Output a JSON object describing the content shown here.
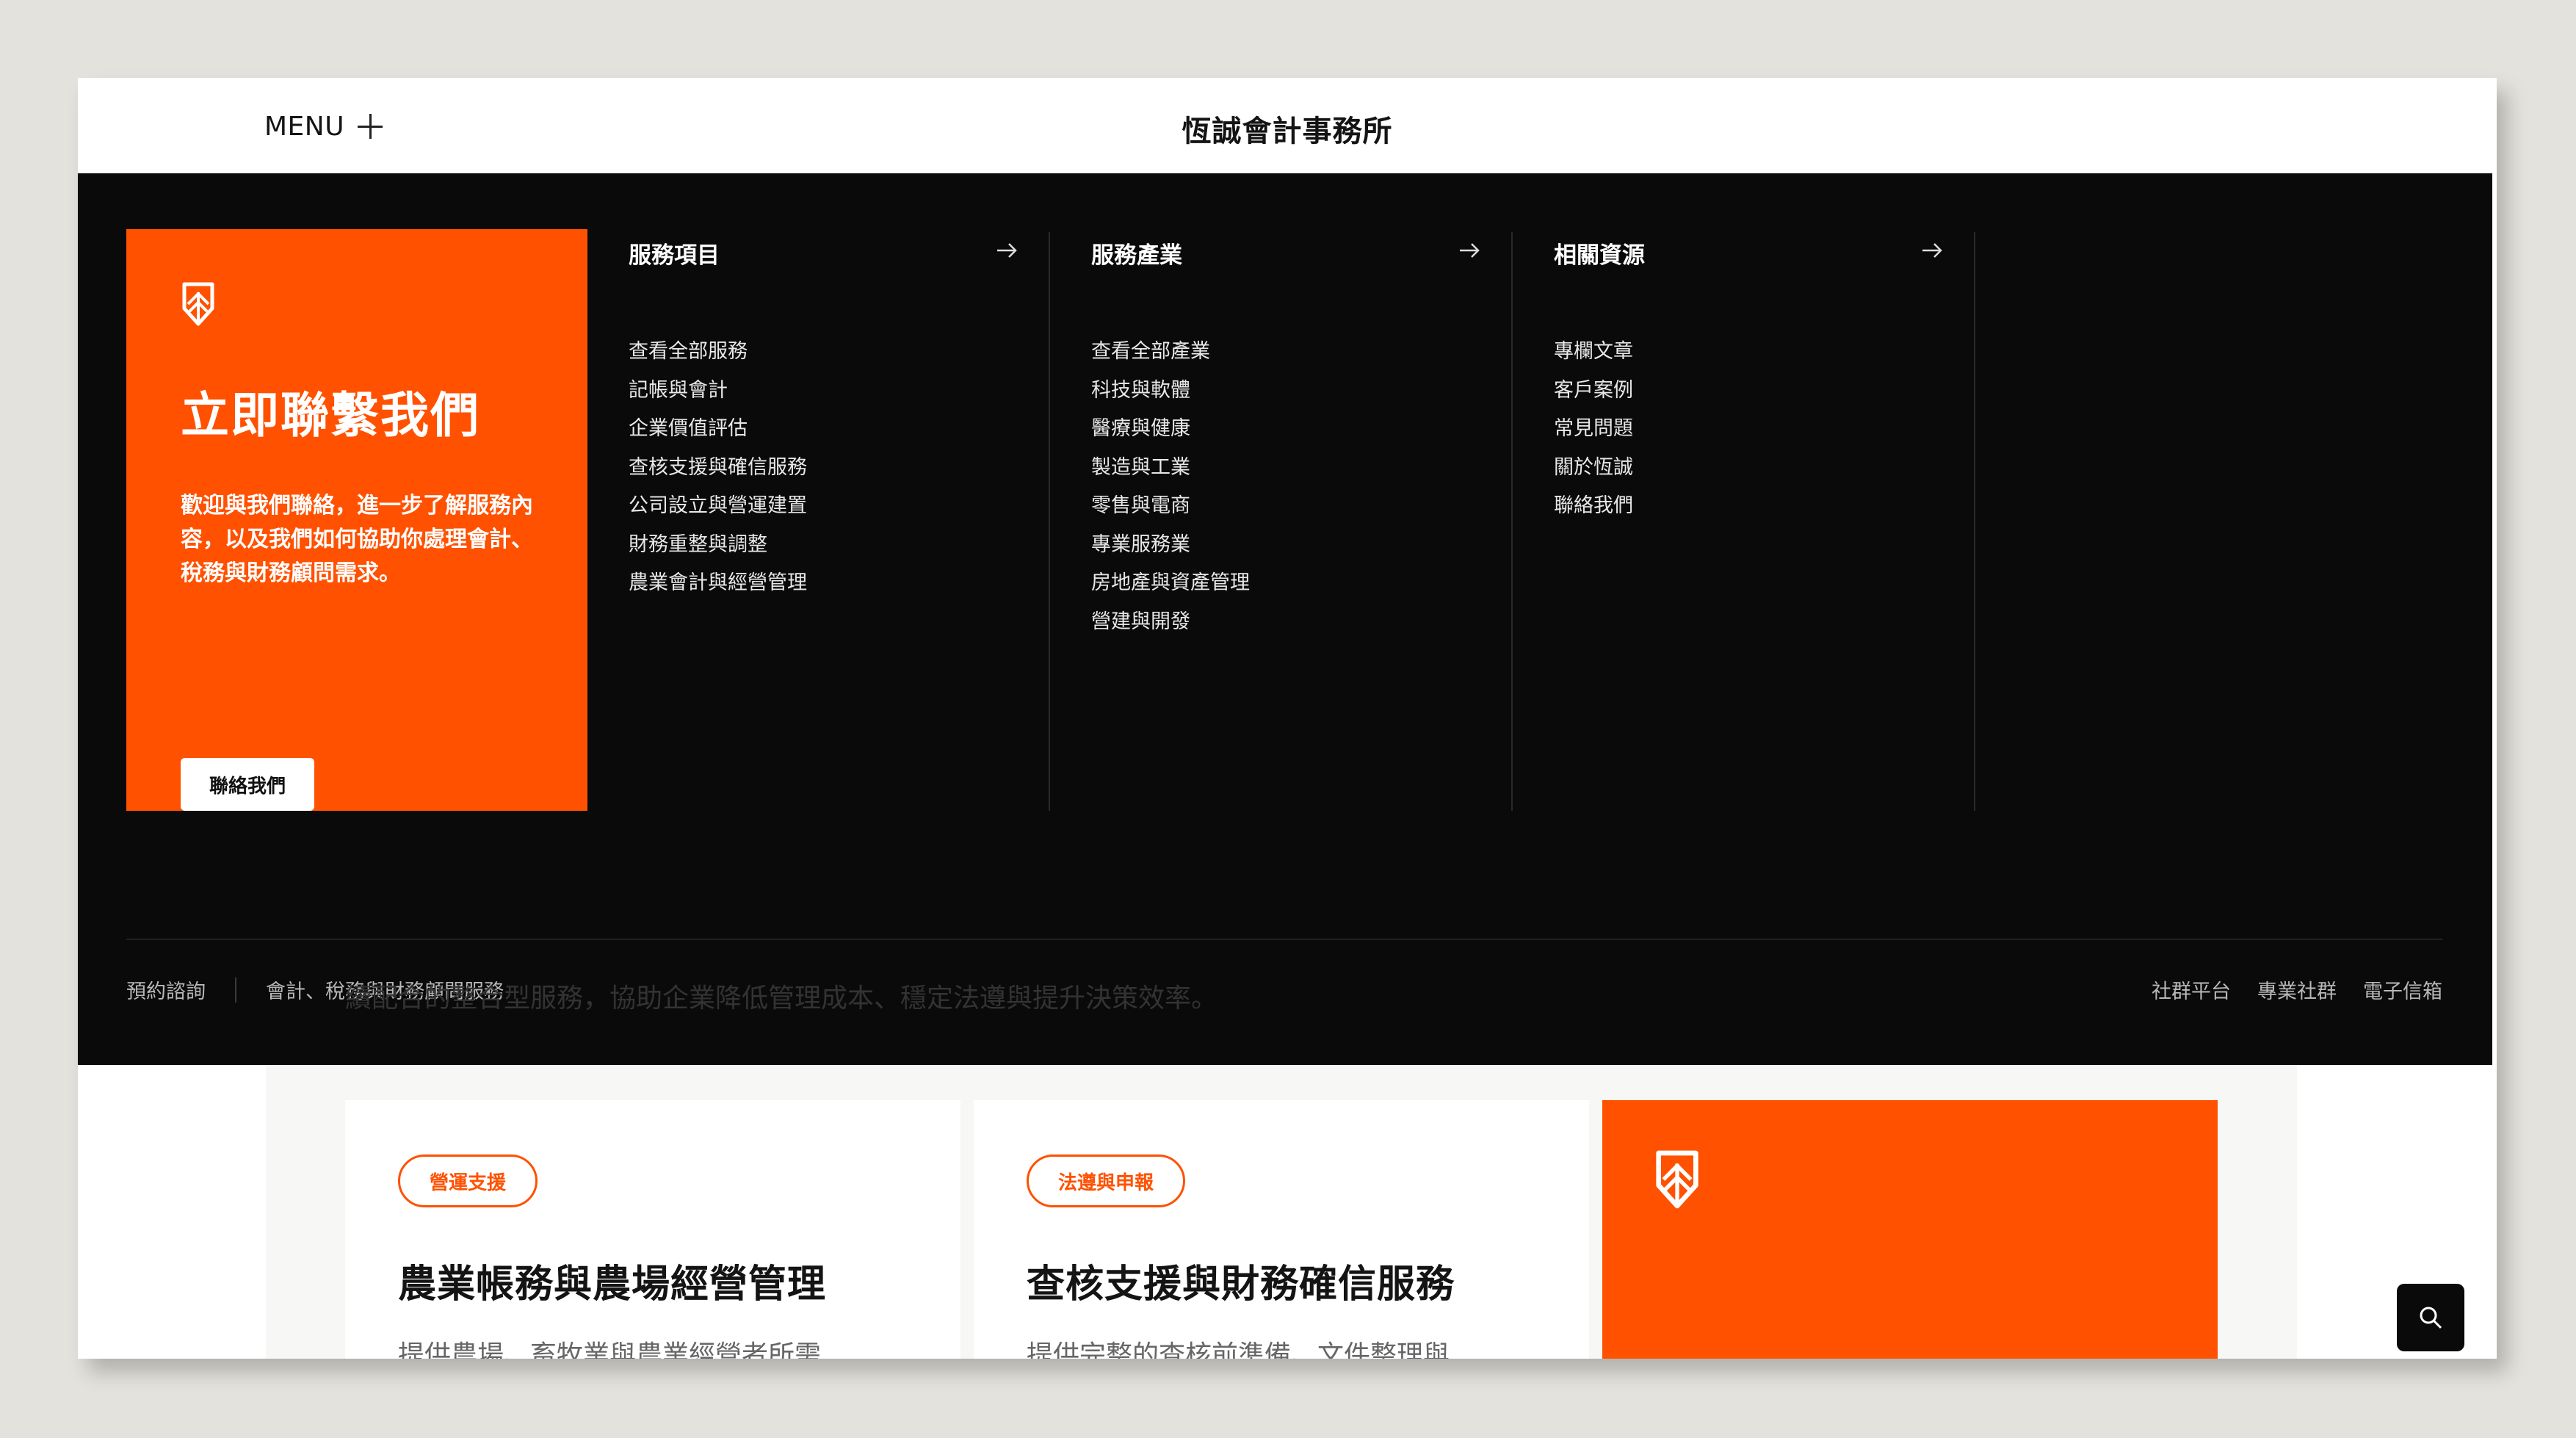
{
  "header": {
    "menu_label": "MENU",
    "site_title": "恆誠會計事務所"
  },
  "mega_menu": {
    "cta": {
      "title": "立即聯繫我們",
      "text": "歡迎與我們聯絡，進一步了解服務內容，以及我們如何協助你處理會計、稅務與財務顧問需求。",
      "button": "聯絡我們"
    },
    "columns": [
      {
        "title": "服務項目",
        "items": [
          "查看全部服務",
          "記帳與會計",
          "企業價值評估",
          "查核支援與確信服務",
          "公司設立與營運建置",
          "財務重整與調整",
          "農業會計與經營管理"
        ]
      },
      {
        "title": "服務產業",
        "items": [
          "查看全部產業",
          "科技與軟體",
          "醫療與健康",
          "製造與工業",
          "零售與電商",
          "專業服務業",
          "房地產與資產管理",
          "營建與開發"
        ]
      },
      {
        "title": "相關資源",
        "items": [
          "專欄文章",
          "客戶案例",
          "常見問題",
          "關於恆誠",
          "聯絡我們"
        ]
      }
    ],
    "footer_left": [
      "預約諮詢",
      "會計、稅務與財務顧問服務"
    ],
    "footer_right": [
      "社群平台",
      "專業社群",
      "電子信箱"
    ]
  },
  "page": {
    "intro_text": "續配合的整合型服務，協助企業降低管理成本、穩定法遵與提升決策效率。",
    "cards": [
      {
        "tag": "營運支援",
        "title": "農業帳務與農場經營管理",
        "desc": "提供農場、畜牧業與農業經營者所需"
      },
      {
        "tag": "法遵與申報",
        "title": "查核支援與財務確信服務",
        "desc": "提供完整的查核前準備、文件整理與"
      }
    ]
  },
  "colors": {
    "accent": "#ff5100",
    "menu_bg": "#0a0a0a",
    "page_bg": "#e3e2dc"
  },
  "icons": [
    "plus-icon",
    "logo-icon",
    "arrow-right-icon",
    "search-icon"
  ]
}
